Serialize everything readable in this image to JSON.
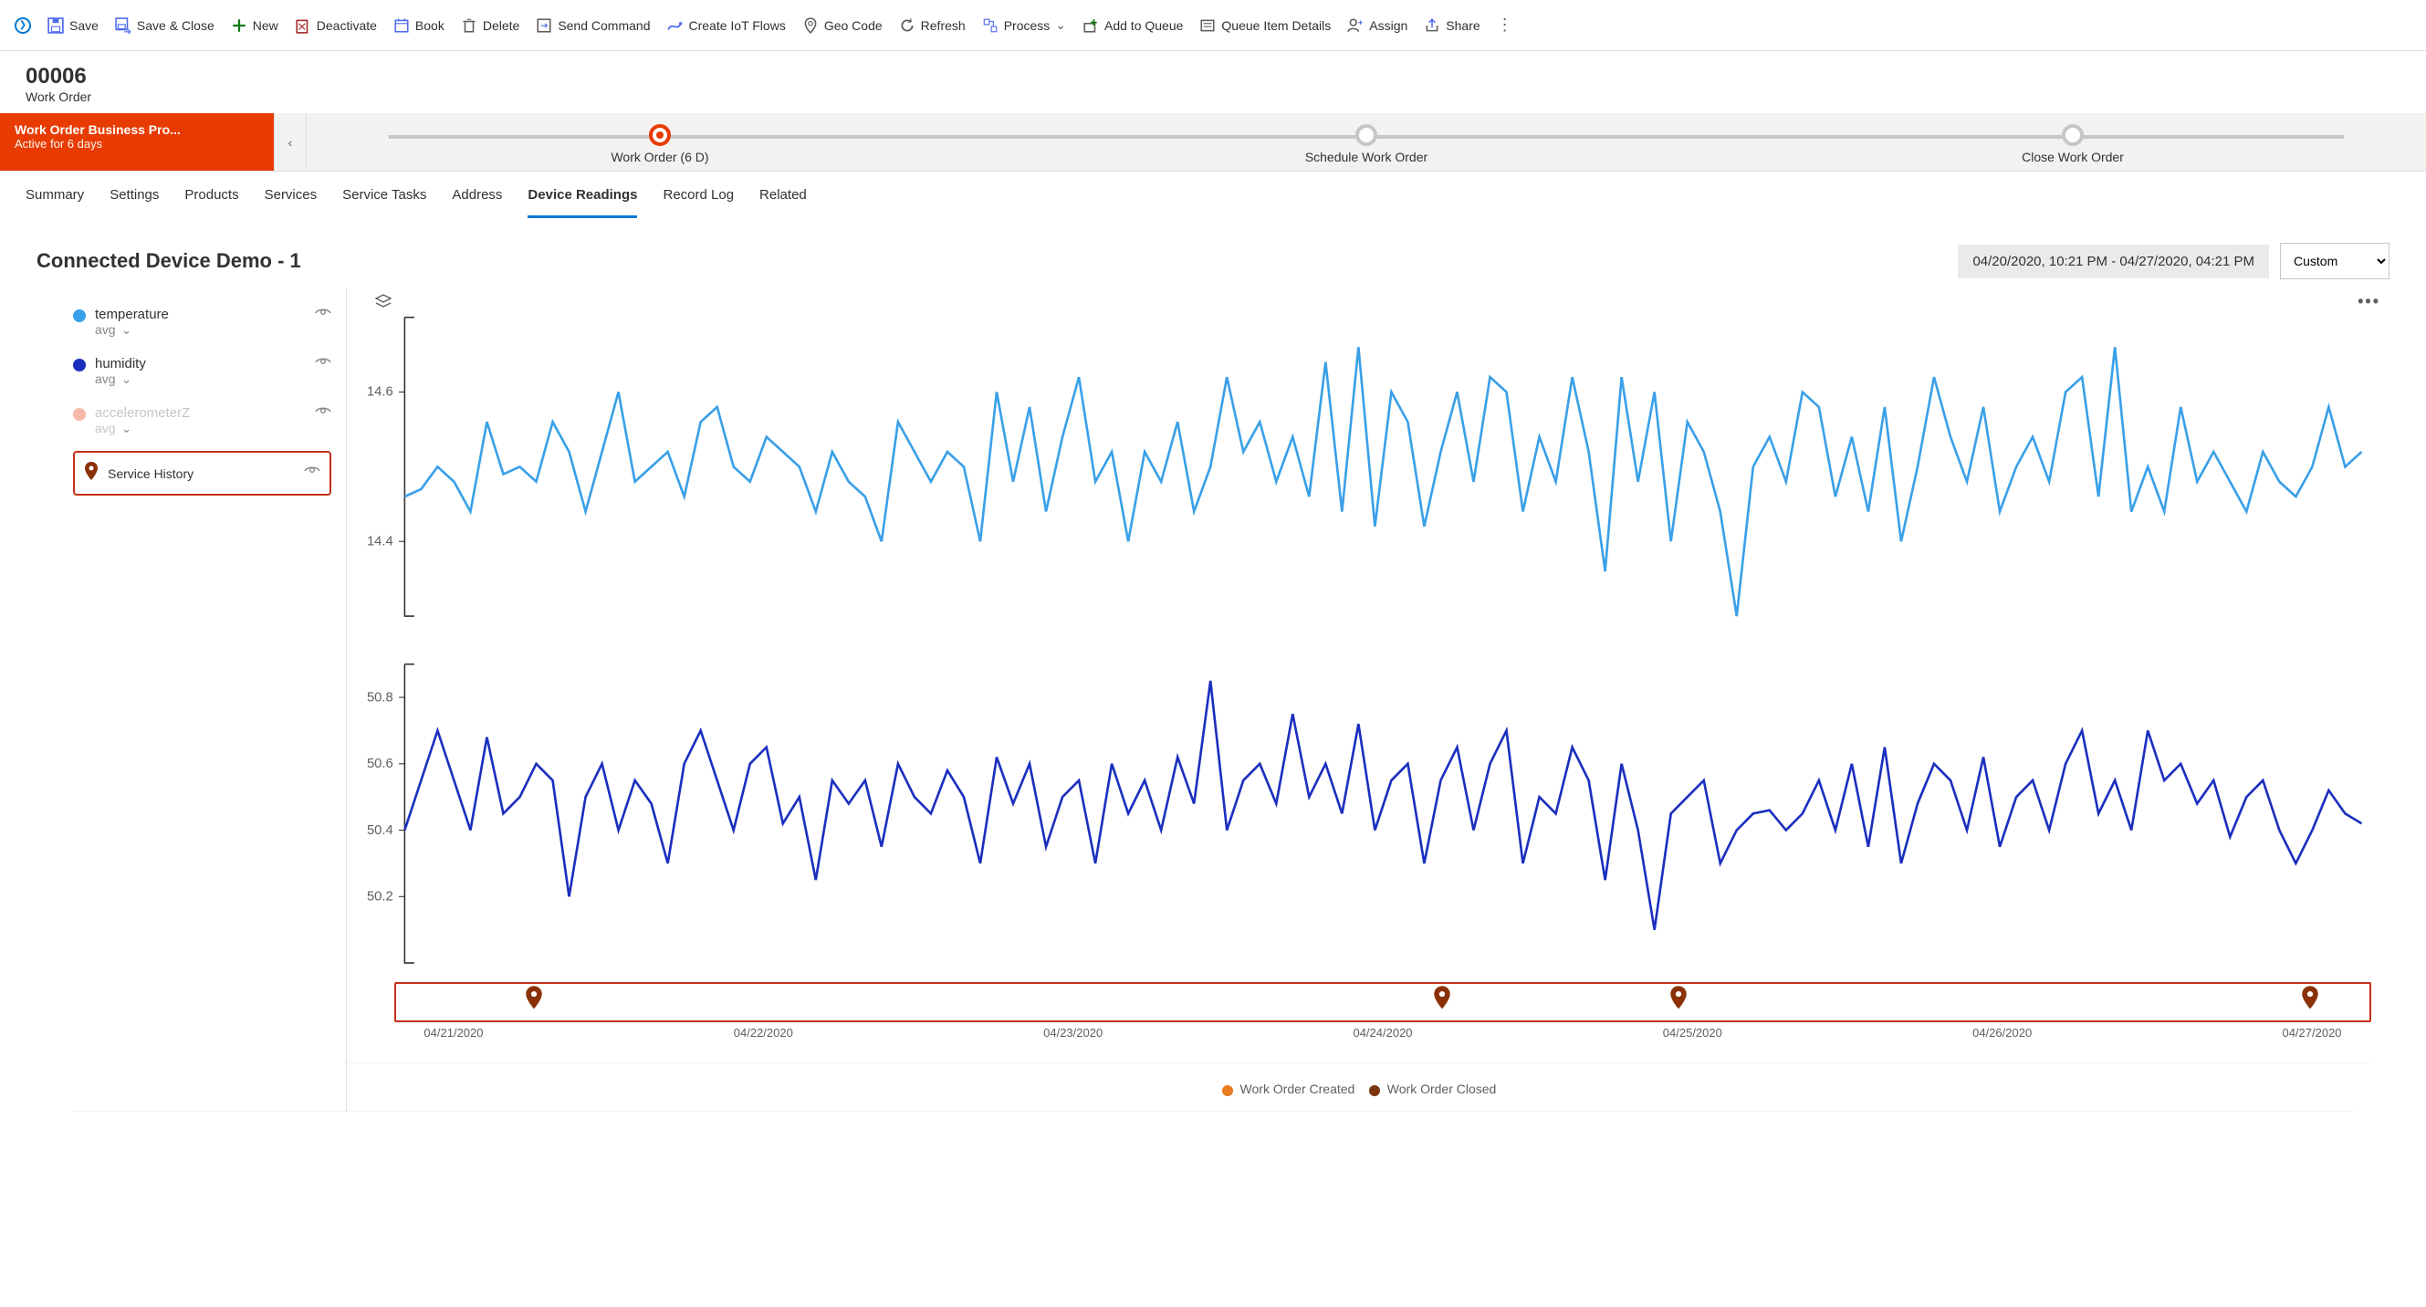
{
  "commands": {
    "save": "Save",
    "save_close": "Save & Close",
    "new": "New",
    "deactivate": "Deactivate",
    "book": "Book",
    "delete": "Delete",
    "send_command": "Send Command",
    "create_iot_flows": "Create IoT Flows",
    "geo_code": "Geo Code",
    "refresh": "Refresh",
    "process": "Process",
    "add_to_queue": "Add to Queue",
    "queue_item_details": "Queue Item Details",
    "assign": "Assign",
    "share": "Share"
  },
  "record": {
    "title": "00006",
    "subtitle": "Work Order"
  },
  "bpf": {
    "proc_title": "Work Order Business Pro...",
    "proc_sub": "Active for 6 days",
    "stages": [
      {
        "label": "Work Order  (6 D)",
        "active": true
      },
      {
        "label": "Schedule Work Order",
        "active": false
      },
      {
        "label": "Close Work Order",
        "active": false
      }
    ]
  },
  "tabs": [
    "Summary",
    "Settings",
    "Products",
    "Services",
    "Service Tasks",
    "Address",
    "Device Readings",
    "Record Log",
    "Related"
  ],
  "tabs_active_index": 6,
  "panel": {
    "title": "Connected Device Demo - 1",
    "range": "04/20/2020, 10:21 PM - 04/27/2020, 04:21 PM",
    "range_option": "Custom"
  },
  "legend": [
    {
      "label": "temperature",
      "sub": "avg",
      "color": "#3aa0e8",
      "visible": true
    },
    {
      "label": "humidity",
      "sub": "avg",
      "color": "#1b2fbf",
      "visible": true
    },
    {
      "label": "accelerometerZ",
      "sub": "avg",
      "color": "#f6b9a9",
      "visible": false
    }
  ],
  "service_history_label": "Service History",
  "chart_legend": {
    "created": "Work Order Created",
    "closed": "Work Order Closed"
  },
  "chart_legend_colors": {
    "created": "#e87b1e",
    "closed": "#7a350e"
  },
  "x_ticks": [
    "04/21/2020",
    "04/22/2020",
    "04/23/2020",
    "04/24/2020",
    "04/25/2020",
    "04/26/2020",
    "04/27/2020"
  ],
  "chart_data": [
    {
      "type": "line",
      "title": "temperature (avg)",
      "ylabel": "",
      "ylim": [
        14.3,
        14.7
      ],
      "y_ticks": [
        14.4,
        14.6
      ],
      "color": "#3aa0e8",
      "n": 120,
      "values": [
        14.46,
        14.47,
        14.5,
        14.48,
        14.44,
        14.56,
        14.49,
        14.5,
        14.48,
        14.56,
        14.52,
        14.44,
        14.52,
        14.6,
        14.48,
        14.5,
        14.52,
        14.46,
        14.56,
        14.58,
        14.5,
        14.48,
        14.54,
        14.52,
        14.5,
        14.44,
        14.52,
        14.48,
        14.46,
        14.4,
        14.56,
        14.52,
        14.48,
        14.52,
        14.5,
        14.4,
        14.6,
        14.48,
        14.58,
        14.44,
        14.54,
        14.62,
        14.48,
        14.52,
        14.4,
        14.52,
        14.48,
        14.56,
        14.44,
        14.5,
        14.62,
        14.52,
        14.56,
        14.48,
        14.54,
        14.46,
        14.64,
        14.44,
        14.66,
        14.42,
        14.6,
        14.56,
        14.42,
        14.52,
        14.6,
        14.48,
        14.62,
        14.6,
        14.44,
        14.54,
        14.48,
        14.62,
        14.52,
        14.36,
        14.62,
        14.48,
        14.6,
        14.4,
        14.56,
        14.52,
        14.44,
        14.3,
        14.5,
        14.54,
        14.48,
        14.6,
        14.58,
        14.46,
        14.54,
        14.44,
        14.58,
        14.4,
        14.5,
        14.62,
        14.54,
        14.48,
        14.58,
        14.44,
        14.5,
        14.54,
        14.48,
        14.6,
        14.62,
        14.46,
        14.66,
        14.44,
        14.5,
        14.44,
        14.58,
        14.48,
        14.52,
        14.48,
        14.44,
        14.52,
        14.48,
        14.46,
        14.5,
        14.58,
        14.5,
        14.52
      ]
    },
    {
      "type": "line",
      "title": "humidity (avg)",
      "ylabel": "",
      "ylim": [
        50.0,
        50.9
      ],
      "y_ticks": [
        50.2,
        50.4,
        50.6,
        50.8
      ],
      "color": "#1b2fbf",
      "n": 120,
      "values": [
        50.4,
        50.55,
        50.7,
        50.55,
        50.4,
        50.68,
        50.45,
        50.5,
        50.6,
        50.55,
        50.2,
        50.5,
        50.6,
        50.4,
        50.55,
        50.48,
        50.3,
        50.6,
        50.7,
        50.55,
        50.4,
        50.6,
        50.65,
        50.42,
        50.5,
        50.25,
        50.55,
        50.48,
        50.55,
        50.35,
        50.6,
        50.5,
        50.45,
        50.58,
        50.5,
        50.3,
        50.62,
        50.48,
        50.6,
        50.35,
        50.5,
        50.55,
        50.3,
        50.6,
        50.45,
        50.55,
        50.4,
        50.62,
        50.48,
        50.85,
        50.4,
        50.55,
        50.6,
        50.48,
        50.75,
        50.5,
        50.6,
        50.45,
        50.72,
        50.4,
        50.55,
        50.6,
        50.3,
        50.55,
        50.65,
        50.4,
        50.6,
        50.7,
        50.3,
        50.5,
        50.45,
        50.65,
        50.55,
        50.25,
        50.6,
        50.4,
        50.1,
        50.45,
        50.5,
        50.55,
        50.3,
        50.4,
        50.45,
        50.46,
        50.4,
        50.45,
        50.55,
        50.4,
        50.6,
        50.35,
        50.65,
        50.3,
        50.48,
        50.6,
        50.55,
        50.4,
        50.62,
        50.35,
        50.5,
        50.55,
        50.4,
        50.6,
        50.7,
        50.45,
        50.55,
        50.4,
        50.7,
        50.55,
        50.6,
        50.48,
        50.55,
        50.38,
        50.5,
        50.55,
        50.4,
        50.3,
        50.4,
        50.52,
        50.45,
        50.42
      ]
    }
  ],
  "service_pins_pct": [
    7,
    53,
    65,
    97
  ]
}
